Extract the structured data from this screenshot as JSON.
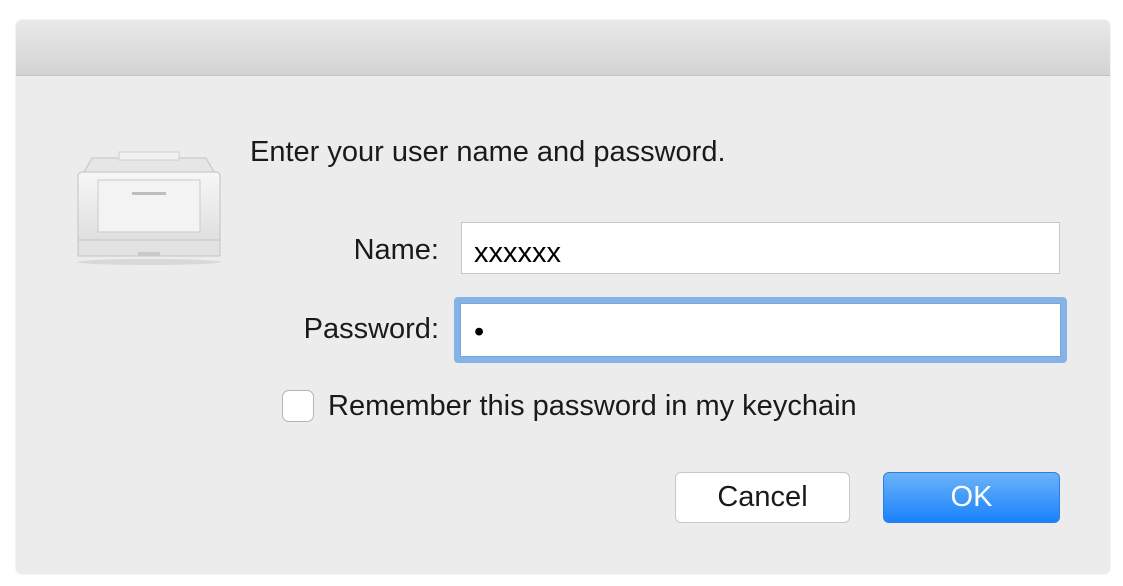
{
  "dialog": {
    "prompt": "Enter your user name and password.",
    "name_label": "Name:",
    "name_value": "xxxxxx",
    "password_label": "Password:",
    "password_value": "•",
    "remember_label": "Remember this password in my keychain",
    "remember_checked": false,
    "cancel_label": "Cancel",
    "ok_label": "OK",
    "icon": "printer-icon"
  },
  "colors": {
    "accent": "#1a82fb",
    "focus_ring": "#86b3e6",
    "window_bg": "#ececec"
  }
}
